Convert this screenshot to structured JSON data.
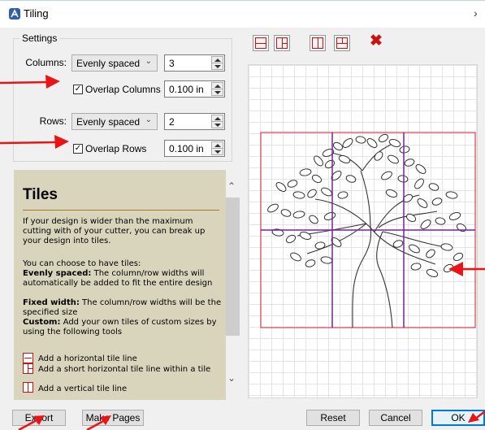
{
  "window": {
    "title": "Tiling",
    "close_glyph": "›"
  },
  "settings": {
    "legend": "Settings",
    "columns": {
      "label": "Columns:",
      "mode": "Evenly spaced",
      "count": "3",
      "overlap_label": "Overlap Columns",
      "overlap_checked": true,
      "overlap_value": "0.100 in"
    },
    "rows": {
      "label": "Rows:",
      "mode": "Evenly spaced",
      "count": "2",
      "overlap_label": "Overlap Rows",
      "overlap_checked": true,
      "overlap_value": "0.100 in"
    }
  },
  "help": {
    "title": "Tiles",
    "intro": "If your design is wider than the maximum cutting with of your cutter, you can break up your design into tiles.",
    "choose": "You can choose to have tiles:",
    "evenly_term": "Evenly spaced:",
    "evenly_desc": " The column/row widths will automatically be added to fit the entire design",
    "fixed_term": "Fixed width:",
    "fixed_desc": " The column/row widths will be the specified size",
    "custom_term": "Custom:",
    "custom_desc": " Add your own tiles of custom sizes by using the following tools",
    "tools": [
      {
        "icon": "horizontal-line-icon",
        "label": "Add a horizontal tile line"
      },
      {
        "icon": "short-horizontal-line-icon",
        "label": "Add a short horizontal tile line within a tile"
      },
      {
        "icon": "vertical-line-icon",
        "label": "Add a vertical tile line"
      }
    ]
  },
  "toolbar": {
    "icons": [
      "add-horizontal-line-icon",
      "add-short-horizontal-line-icon",
      "add-vertical-line-icon",
      "add-short-vertical-line-icon",
      "delete-line-icon"
    ]
  },
  "footer": {
    "export": "Export",
    "make_pages": "Make Pages",
    "reset": "Reset",
    "cancel": "Cancel",
    "ok": "OK"
  },
  "colors": {
    "annotation_arrow": "#e81416",
    "tile_outline": "#e0404f",
    "tile_line": "#7a1fa2",
    "help_bg": "#d9d5bd",
    "help_rule": "#a37a2b"
  }
}
